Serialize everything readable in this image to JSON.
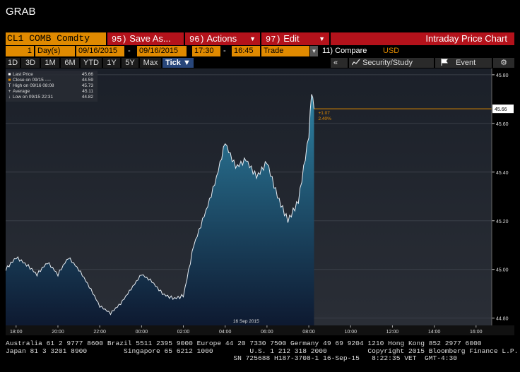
{
  "window": {
    "title": "GRAB"
  },
  "toolbar": {
    "security": "CL1 COMB Comdty",
    "save_code": "95)",
    "save_label": "Save As...",
    "actions_code": "96)",
    "actions_label": "Actions",
    "edit_code": "97)",
    "edit_label": "Edit",
    "chart_title": "Intraday Price Chart"
  },
  "params": {
    "period_value": "1",
    "period_unit": "Day(s)",
    "start_date": "09/16/2015",
    "date_sep": "-",
    "end_date": "09/16/2015",
    "start_time": "17:30",
    "time_sep": "-",
    "end_time": "16:45",
    "event_type": "Trade",
    "compare_label": "11) Compare",
    "currency": "USD"
  },
  "ranges": [
    {
      "label": "1D",
      "active": false
    },
    {
      "label": "3D",
      "active": false
    },
    {
      "label": "1M",
      "active": false
    },
    {
      "label": "6M",
      "active": false
    },
    {
      "label": "YTD",
      "active": false
    },
    {
      "label": "1Y",
      "active": false
    },
    {
      "label": "5Y",
      "active": false
    },
    {
      "label": "Max",
      "active": false
    },
    {
      "label": "Tick ▼",
      "active": true
    }
  ],
  "tools": {
    "collapse": "«",
    "security_study": "Security/Study",
    "event": "Event",
    "settings_icon": "gear-icon"
  },
  "legend": [
    {
      "mark": "■",
      "label": "Last Price",
      "value": "45.66"
    },
    {
      "mark": "■",
      "label": "Close on 09/15 ----",
      "value": "44.59"
    },
    {
      "mark": "T",
      "label": "High on 09/16 08:08",
      "value": "45.73"
    },
    {
      "mark": "+",
      "label": "Average",
      "value": "45.11"
    },
    {
      "mark": "↓",
      "label": "Low on 09/15 22:31",
      "value": "44.82"
    }
  ],
  "annotation": {
    "change": "+1.07",
    "pct": "2.40%"
  },
  "last_price_tag": "45.66",
  "date_label": "16 Sep 2015",
  "footer": {
    "line1": "Australia 61 2 9777 8600 Brazil 5511 2395 9000 Europe 44 20 7330 7500 Germany 49 69 9204 1210 Hong Kong 852 2977 6000",
    "line2": "Japan 81 3 3201 8900         Singapore 65 6212 1000         U.S. 1 212 318 2000          Copyright 2015 Bloomberg Finance L.P.",
    "line3": "                                                        SN 725688 H187-3708-1 16-Sep-15   8:22:35 VET  GMT-4:30"
  },
  "colors": {
    "orange": "#e08a00",
    "red": "#b4121b",
    "active_tab": "#28467a",
    "area_top": "#2e86a8",
    "area_bottom": "#0c1830"
  },
  "chart_data": {
    "type": "area",
    "title": "",
    "xlabel": "",
    "ylabel": "",
    "x_ticks": [
      "18:00",
      "20:00",
      "22:00",
      "00:00",
      "02:00",
      "04:00",
      "06:00",
      "08:00",
      "10:00",
      "12:00",
      "14:00",
      "16:00"
    ],
    "y_ticks": [
      "44.80",
      "45.00",
      "45.20",
      "45.40",
      "45.60",
      "45.80"
    ],
    "ylim": [
      44.77,
      45.82
    ],
    "xlim_hours_from_1730": [
      0,
      23.25
    ],
    "reference_line": 45.66,
    "series": [
      {
        "name": "Last Price",
        "x": [
          "17:30",
          "18:00",
          "18:30",
          "19:00",
          "19:30",
          "20:00",
          "20:30",
          "21:00",
          "21:30",
          "22:00",
          "22:31",
          "23:00",
          "23:30",
          "00:00",
          "00:30",
          "01:00",
          "01:30",
          "02:00",
          "02:30",
          "03:00",
          "03:30",
          "04:00",
          "04:30",
          "05:00",
          "05:30",
          "06:00",
          "06:30",
          "07:00",
          "07:30",
          "08:00",
          "08:08",
          "08:15"
        ],
        "y": [
          45.0,
          45.05,
          45.02,
          44.98,
          45.03,
          44.98,
          45.05,
          45.0,
          44.93,
          44.85,
          44.82,
          44.86,
          44.92,
          44.98,
          44.95,
          44.9,
          44.88,
          44.89,
          45.1,
          45.22,
          45.35,
          45.52,
          45.42,
          45.45,
          45.38,
          45.44,
          45.3,
          45.2,
          45.28,
          45.55,
          45.73,
          45.66
        ]
      }
    ]
  }
}
